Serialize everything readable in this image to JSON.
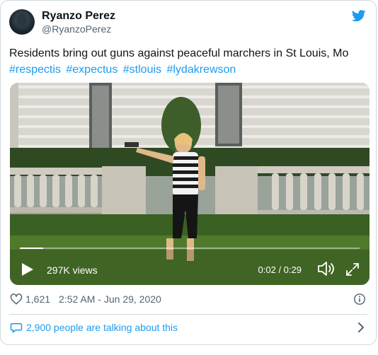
{
  "author": {
    "name": "Ryanzo Perez",
    "handle": "@RyanzoPerez"
  },
  "tweet": {
    "text": "Residents bring out guns against peaceful marchers in St Louis, Mo",
    "hashtags": [
      "#respectis",
      "#expectus",
      "#stlouis",
      "#lydakrewson"
    ]
  },
  "video": {
    "views": "297K views",
    "time": "0:02 / 0:29",
    "progress": 0.069
  },
  "stats": {
    "likes": "1,621",
    "timestamp": "2:52 AM - Jun 29, 2020"
  },
  "conversation": {
    "label": "2,900 people are talking about this"
  },
  "colors": {
    "accent": "#1d9bf0",
    "secondary_text": "#536471",
    "border": "#cfd9de"
  },
  "icons": [
    "twitter-bird-icon",
    "play-icon",
    "volume-icon",
    "fullscreen-icon",
    "heart-icon",
    "info-icon",
    "speech-bubble-icon",
    "chevron-right-icon"
  ]
}
